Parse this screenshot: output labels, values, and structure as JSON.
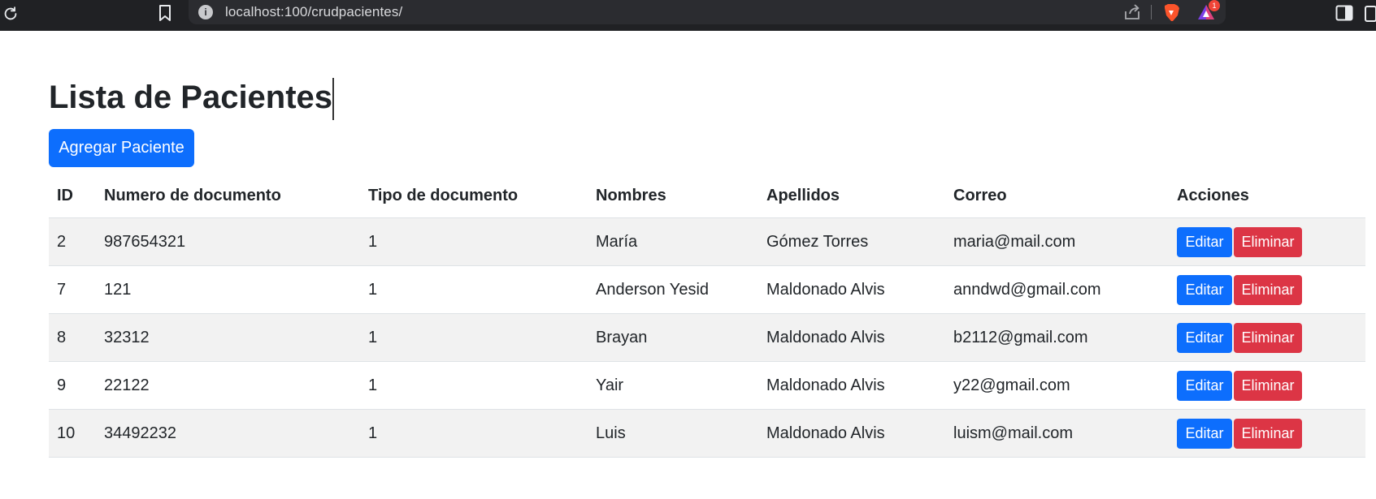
{
  "browser": {
    "url": "localhost:100/crudpacientes/",
    "notification_count": "1"
  },
  "page": {
    "title": "Lista de Pacientes",
    "add_button_label": "Agregar Paciente"
  },
  "table": {
    "headers": {
      "id": "ID",
      "numero_documento": "Numero de documento",
      "tipo_documento": "Tipo de documento",
      "nombres": "Nombres",
      "apellidos": "Apellidos",
      "correo": "Correo",
      "acciones": "Acciones"
    },
    "actions": {
      "edit_label": "Editar",
      "delete_label": "Eliminar"
    },
    "rows": [
      {
        "id": "2",
        "numero_documento": "987654321",
        "tipo_documento": "1",
        "nombres": "María",
        "apellidos": "Gómez Torres",
        "correo": "maria@mail.com"
      },
      {
        "id": "7",
        "numero_documento": "121",
        "tipo_documento": "1",
        "nombres": "Anderson Yesid",
        "apellidos": "Maldonado Alvis",
        "correo": "anndwd@gmail.com"
      },
      {
        "id": "8",
        "numero_documento": "32312",
        "tipo_documento": "1",
        "nombres": "Brayan",
        "apellidos": "Maldonado Alvis",
        "correo": "b2112@gmail.com"
      },
      {
        "id": "9",
        "numero_documento": "22122",
        "tipo_documento": "1",
        "nombres": "Yair",
        "apellidos": "Maldonado Alvis",
        "correo": "y22@gmail.com"
      },
      {
        "id": "10",
        "numero_documento": "34492232",
        "tipo_documento": "1",
        "nombres": "Luis",
        "apellidos": "Maldonado Alvis",
        "correo": "luism@mail.com"
      }
    ]
  }
}
